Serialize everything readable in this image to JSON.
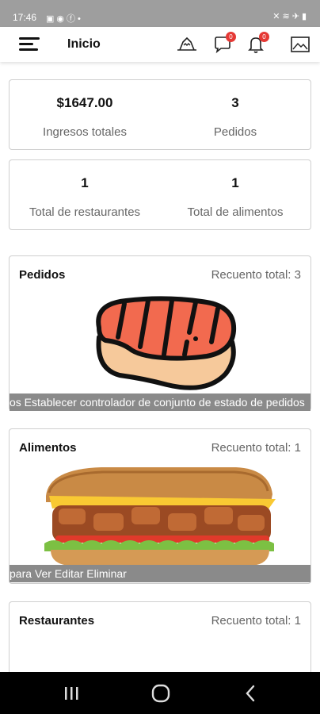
{
  "status_bar": {
    "time": "17:46",
    "left_icons": [
      "image-icon",
      "message-icon",
      "facebook-icon",
      "dot-icon"
    ],
    "right_icons": [
      "mute-icon",
      "wifi-icon",
      "airplane-icon",
      "battery-icon"
    ]
  },
  "app_bar": {
    "title": "Inicio",
    "notifications": [
      {
        "icon": "chat-bubble-icon",
        "badge": "0"
      },
      {
        "icon": "bell-icon",
        "badge": "0"
      }
    ],
    "colors": {
      "badge": "#e53935"
    }
  },
  "stats": {
    "income_value": "$1647.00",
    "income_label": "Ingresos totales",
    "orders_value": "3",
    "orders_label": "Pedidos",
    "restaurants_value": "1",
    "restaurants_label": "Total de restaurantes",
    "foods_value": "1",
    "foods_label": "Total de alimentos"
  },
  "sections": {
    "orders": {
      "title": "Pedidos",
      "count": "Recuento total: 3",
      "ticker": "os Establecer controlador de conjunto de estado de pedidos"
    },
    "foods": {
      "title": "Alimentos",
      "count": "Recuento total: 1",
      "ticker": "para Ver Editar Eliminar"
    },
    "restaurants": {
      "title": "Restaurantes",
      "count": "Recuento total: 1"
    }
  },
  "nav_bar": {
    "buttons": [
      "recents-icon",
      "home-icon",
      "back-icon"
    ]
  }
}
